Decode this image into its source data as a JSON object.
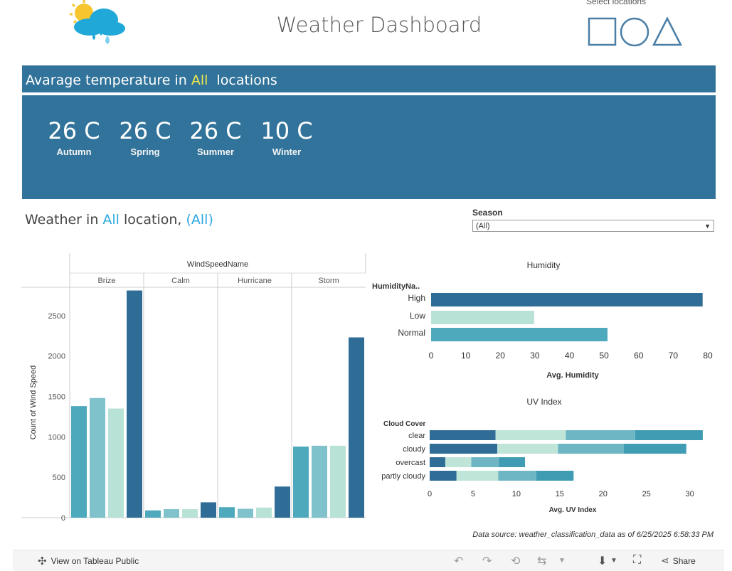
{
  "header": {
    "title": "Weather Dashboard",
    "select_locations_label": "Select locations",
    "location_shapes": [
      "square-icon",
      "circle-icon",
      "triangle-icon"
    ]
  },
  "temperature": {
    "heading_prefix": "Avarage temperature in ",
    "heading_highlight": "All",
    "heading_suffix": "  locations",
    "items": [
      {
        "value": "26 C",
        "season": "Autumn"
      },
      {
        "value": "26 C",
        "season": "Spring"
      },
      {
        "value": "26 C",
        "season": "Summer"
      },
      {
        "value": "10 C",
        "season": "Winter"
      }
    ]
  },
  "weather_section": {
    "prefix": "Weather in ",
    "location": "All",
    "middle": " location, ",
    "season": "(All)"
  },
  "season_filter": {
    "label": "Season",
    "value": "(All)"
  },
  "colors": {
    "dark_blue": "#31739a",
    "light_teal": "#b8e2d6",
    "mid_teal": "#4fa9bd",
    "pale_teal": "#7fc2cc",
    "deep_blue": "#2f6d96",
    "header_bg": "#31739a"
  },
  "chart_data": [
    {
      "type": "bar",
      "title": "",
      "group_header": "WindSpeedName",
      "groups": [
        "Brize",
        "Calm",
        "Hurricane",
        "Storm"
      ],
      "ylabel": "Count of Wind Speed",
      "yticks": [
        0,
        500,
        1000,
        1500,
        2000,
        2500
      ],
      "ylim": [
        0,
        2850
      ],
      "series": [
        {
          "values": [
            1380,
            90,
            130,
            880
          ]
        },
        {
          "values": [
            1480,
            105,
            110,
            890
          ]
        },
        {
          "values": [
            1350,
            105,
            125,
            890
          ]
        },
        {
          "values": [
            2810,
            190,
            385,
            2230
          ]
        }
      ]
    },
    {
      "type": "bar",
      "orientation": "horizontal",
      "title": "Humidity",
      "row_header": "HumidityNa..",
      "categories": [
        "High",
        "Low",
        "Normal"
      ],
      "values": [
        78.5,
        29.8,
        51.0
      ],
      "xlabel": "Avg. Humidity",
      "xticks": [
        0,
        10,
        20,
        30,
        40,
        50,
        60,
        70,
        80
      ],
      "xlim": [
        0,
        80
      ]
    },
    {
      "type": "bar",
      "orientation": "horizontal",
      "stacked": true,
      "title": "UV Index",
      "row_header": "Cloud Cover",
      "categories": [
        "clear",
        "cloudy",
        "overcast",
        "partly cloudy"
      ],
      "xlabel": "Avg. UV Index",
      "xticks": [
        0,
        5,
        10,
        15,
        20,
        25,
        30
      ],
      "xlim": [
        0,
        32
      ],
      "series": [
        {
          "values": [
            7.6,
            7.8,
            1.8,
            3.1
          ]
        },
        {
          "values": [
            8.1,
            7.0,
            3.0,
            4.8
          ]
        },
        {
          "values": [
            8.0,
            7.6,
            3.2,
            4.4
          ]
        },
        {
          "values": [
            7.8,
            7.2,
            3.0,
            4.3
          ]
        }
      ]
    }
  ],
  "footer": {
    "data_source": "Data source: weather_classification_data as of 6/25/2025 6:58:33 PM",
    "tableau_link": "View on Tableau Public",
    "share": "Share"
  }
}
